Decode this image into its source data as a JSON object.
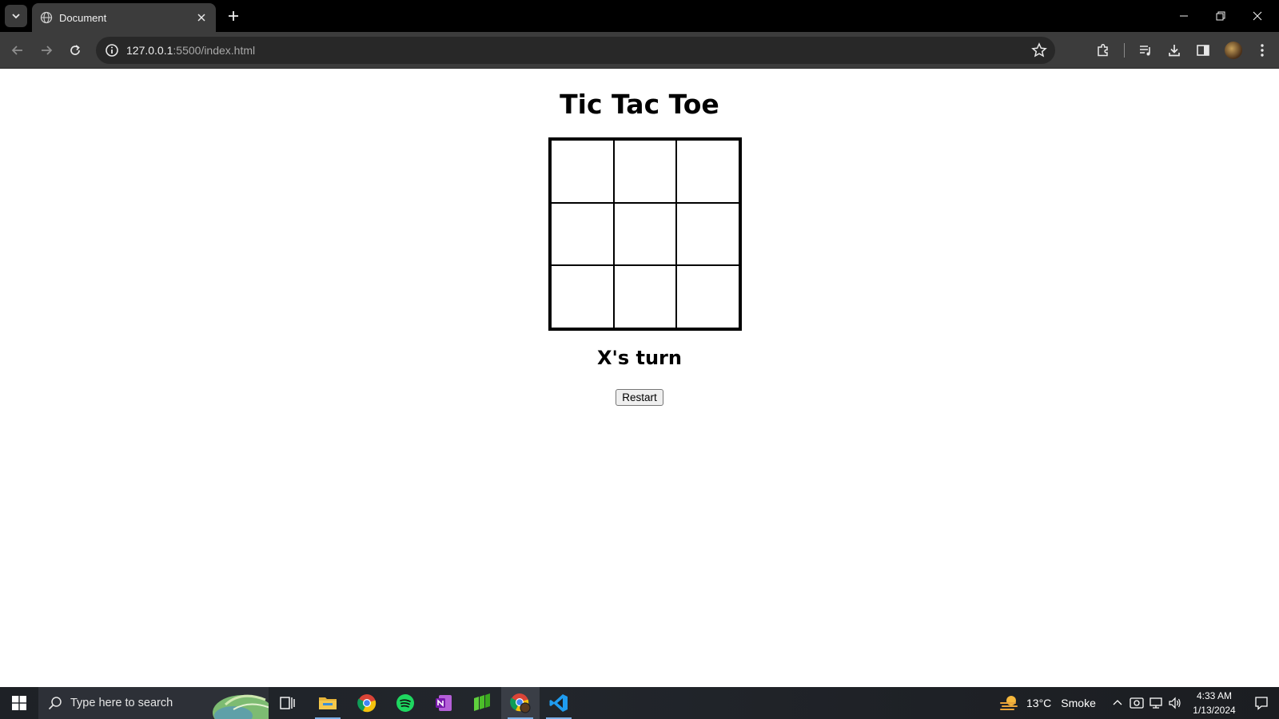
{
  "browser": {
    "tab_title": "Document",
    "url_host": "127.0.0.1",
    "url_rest": ":5500/index.html"
  },
  "page": {
    "title": "Tic Tac Toe",
    "status": "X's turn",
    "restart_label": "Restart",
    "board": [
      "",
      "",
      "",
      "",
      "",
      "",
      "",
      "",
      ""
    ]
  },
  "taskbar": {
    "search_placeholder": "Type here to search",
    "weather_temp": "13°C",
    "weather_condition": "Smoke",
    "time": "4:33 AM",
    "date": "1/13/2024"
  },
  "icons": {
    "tab_menu": "chevron-down-icon",
    "favicon": "globe-icon",
    "tab_close": "close-icon",
    "new_tab": "plus-icon",
    "minimize": "minimize-icon",
    "restore": "restore-icon",
    "window_close": "close-icon",
    "back": "back-arrow-icon",
    "forward": "forward-arrow-icon",
    "reload": "reload-icon",
    "site_info": "info-icon",
    "bookmark": "star-icon",
    "extensions": "puzzle-icon",
    "media": "media-control-icon",
    "downloads": "download-icon",
    "side_panel": "side-panel-icon",
    "menu": "kebab-menu-icon",
    "windows_start": "windows-logo-icon",
    "search": "search-icon",
    "task_view": "task-view-icon",
    "file_explorer": "folder-icon",
    "chrome": "chrome-icon",
    "spotify": "spotify-icon",
    "onenote": "onenote-icon",
    "app_green": "green-app-icon",
    "chrome_profile": "chrome-profile-icon",
    "vscode": "vscode-icon",
    "weather": "weather-icon",
    "tray_chevron": "chevron-up-icon",
    "network": "network-icon",
    "volume": "volume-icon",
    "notifications": "notification-icon"
  },
  "colors": {
    "tabbar_bg": "#000000",
    "toolbar_bg": "#3c3c3c",
    "page_bg": "#ffffff",
    "board_line": "#000000",
    "taskbar_bg": "#1e2126",
    "taskbar_active": "#7cb0e8"
  }
}
